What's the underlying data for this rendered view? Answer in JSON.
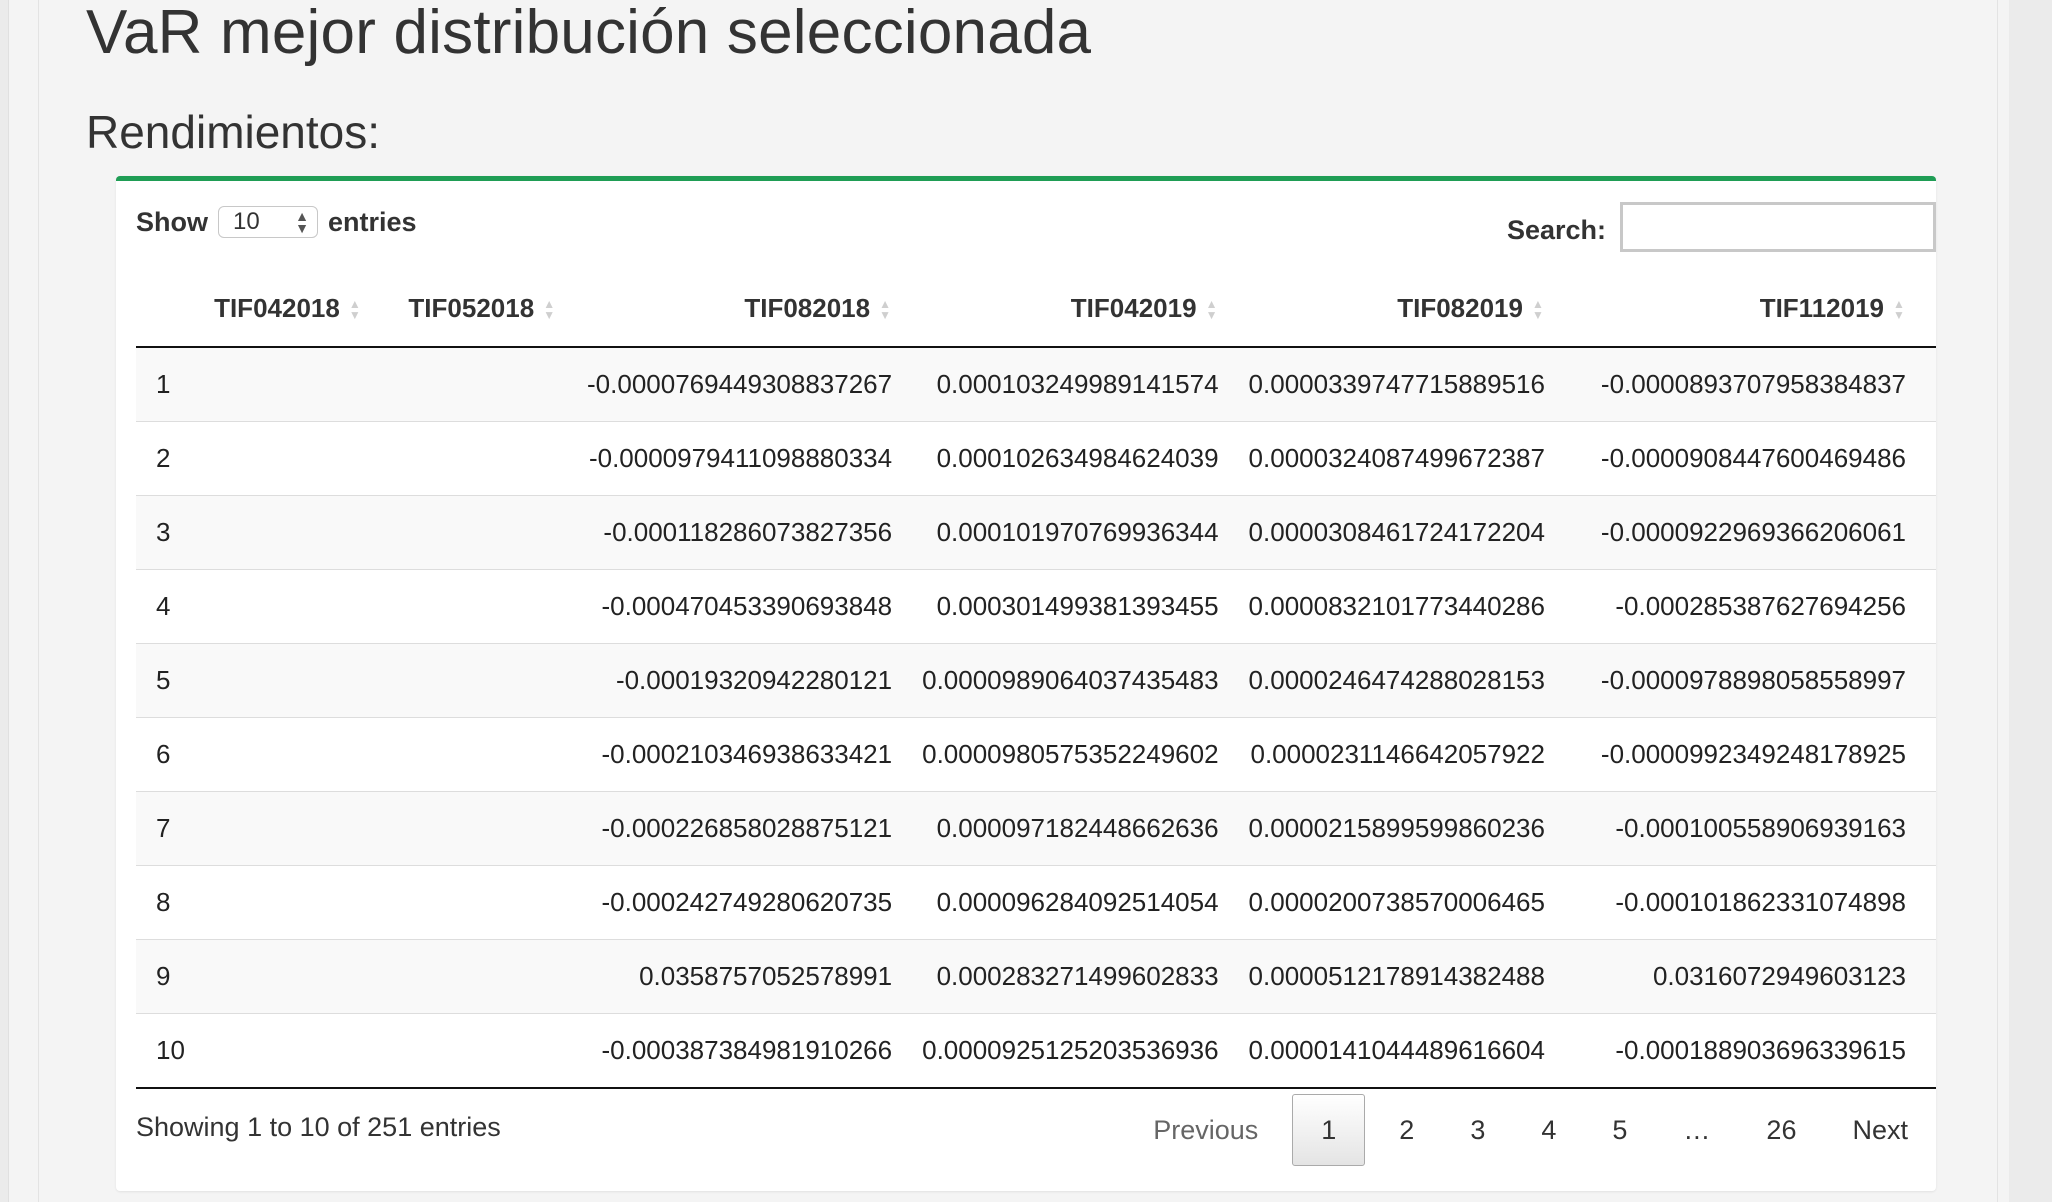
{
  "page": {
    "title": "VaR mejor distribución seleccionada",
    "subtitle": "Rendimientos:"
  },
  "controls": {
    "show_label": "Show",
    "entries_label": "entries",
    "length_value": "10",
    "search_label": "Search:",
    "search_value": ""
  },
  "table": {
    "columns": [
      "",
      "TIF042018",
      "TIF052018",
      "TIF082018",
      "TIF042019",
      "TIF082019",
      "TIF112019"
    ],
    "rows": [
      [
        "1",
        "",
        "",
        "-0.0000769449308837267",
        "0.000103249989141574",
        "0.0000339747715889516",
        "-0.0000893707958384837"
      ],
      [
        "2",
        "",
        "",
        "-0.0000979411098880334",
        "0.000102634984624039",
        "0.0000324087499672387",
        "-0.0000908447600469486"
      ],
      [
        "3",
        "",
        "",
        "-0.000118286073827356",
        "0.000101970769936344",
        "0.0000308461724172204",
        "-0.0000922969366206061"
      ],
      [
        "4",
        "",
        "",
        "-0.000470453390693848",
        "0.000301499381393455",
        "0.0000832101773440286",
        "-0.000285387627694256"
      ],
      [
        "5",
        "",
        "",
        "-0.00019320942280121",
        "0.0000989064037435483",
        "0.0000246474288028153",
        "-0.0000978898058558997"
      ],
      [
        "6",
        "",
        "",
        "-0.000210346938633421",
        "0.0000980575352249602",
        "0.0000231146642057922",
        "-0.0000992349248178925"
      ],
      [
        "7",
        "",
        "",
        "-0.000226858028875121",
        "0.000097182448662636",
        "0.0000215899599860236",
        "-0.000100558906939163"
      ],
      [
        "8",
        "",
        "",
        "-0.000242749280620735",
        "0.000096284092514054",
        "0.0000200738570006465",
        "-0.000101862331074898"
      ],
      [
        "9",
        "",
        "",
        "0.0358757052578991",
        "0.000283271499602833",
        "0.0000512178914382488",
        "0.0316072949603123"
      ],
      [
        "10",
        "",
        "",
        "-0.000387384981910266",
        "0.0000925125203536936",
        "0.0000141044489616604",
        "-0.000188903696339615"
      ]
    ]
  },
  "footer": {
    "info": "Showing 1 to 10 of 251 entries",
    "previous": "Previous",
    "pages": [
      "1",
      "2",
      "3",
      "4",
      "5",
      "…",
      "26"
    ],
    "next": "Next",
    "current_page": "1"
  },
  "colors": {
    "accent": "#1f9d55"
  }
}
